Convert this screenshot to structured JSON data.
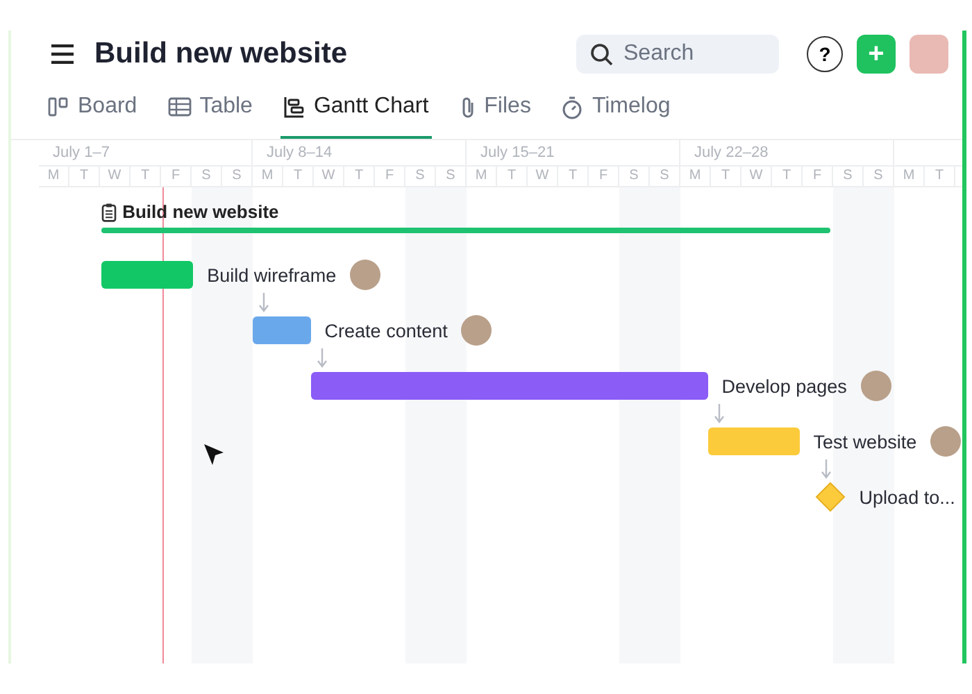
{
  "header": {
    "title": "Build new website",
    "search": {
      "placeholder": "Search"
    },
    "help": "?",
    "add": "+"
  },
  "tabs": [
    {
      "label": "Board",
      "selected": false
    },
    {
      "label": "Table",
      "selected": false
    },
    {
      "label": "Gantt Chart",
      "selected": true
    },
    {
      "label": "Files",
      "selected": false
    },
    {
      "label": "Timelog",
      "selected": false
    }
  ],
  "weeks": [
    "July 1–7",
    "July 8–14",
    "July 15–21",
    "July 22–28"
  ],
  "days": [
    "M",
    "T",
    "W",
    "T",
    "F",
    "S",
    "S",
    "M",
    "T",
    "W",
    "T",
    "F",
    "S",
    "S",
    "M",
    "T",
    "W",
    "T",
    "F",
    "S",
    "S",
    "M",
    "T",
    "W",
    "T",
    "F",
    "S",
    "S",
    "M",
    "T"
  ],
  "project": {
    "name": "Build new website"
  },
  "tasks": [
    {
      "name": "Build wireframe",
      "kind": "bar",
      "color": "#12c866"
    },
    {
      "name": "Create content",
      "kind": "bar",
      "color": "#6aa8ec"
    },
    {
      "name": "Develop pages",
      "kind": "bar",
      "color": "#8b5cf6"
    },
    {
      "name": "Test website",
      "kind": "bar",
      "color": "#fbcb3c"
    },
    {
      "name": "Upload to...",
      "kind": "milestone",
      "color": "#fbcb3c"
    }
  ]
}
